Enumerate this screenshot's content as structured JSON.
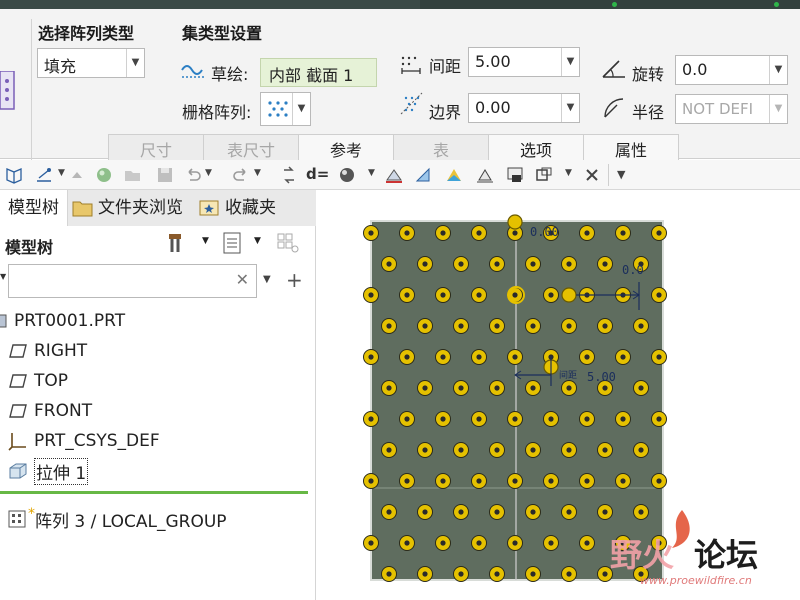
{
  "ribbon": {
    "pattern_type": {
      "title": "选择阵列类型",
      "value": "填充"
    },
    "set_type": {
      "title": "集类型设置",
      "sketch_label": "草绘:",
      "sketch_value": "内部 截面 1",
      "grid_label": "栅格阵列:"
    },
    "spacing": {
      "label": "间距",
      "value": "5.00"
    },
    "border": {
      "label": "边界",
      "value": "0.00"
    },
    "rotate": {
      "label": "旋转",
      "value": "0.0"
    },
    "radius": {
      "label": "半径",
      "value": "NOT DEFI"
    },
    "tabs": [
      {
        "label": "尺寸",
        "enabled": false
      },
      {
        "label": "表尺寸",
        "enabled": false
      },
      {
        "label": "参考",
        "enabled": true
      },
      {
        "label": "表",
        "enabled": false
      },
      {
        "label": "选项",
        "enabled": true
      },
      {
        "label": "属性",
        "enabled": true
      }
    ]
  },
  "toolbar": {
    "icons": [
      "orient-icon",
      "sketch-view-icon",
      "up-arrow-icon",
      "sphere-icon",
      "open-icon",
      "save-icon",
      "undo-icon",
      "redo-icon",
      "regenerate-icon",
      "dimension-icon",
      "appearance-icon",
      "datum-display-icon",
      "section-icon",
      "color-icon",
      "plane-display-icon",
      "screenshot-icon",
      "window-icon",
      "close-window-icon",
      "more-icon"
    ],
    "dimension_text": "d="
  },
  "left_panel": {
    "tabs": [
      "模型树",
      "文件夹浏览",
      "收藏夹"
    ],
    "tree_title": "模型树",
    "search": {
      "value": "",
      "placeholder": ""
    },
    "items": [
      {
        "label": "PRT0001.PRT",
        "icon": "part-icon"
      },
      {
        "label": "RIGHT",
        "icon": "datum-plane-icon"
      },
      {
        "label": "TOP",
        "icon": "datum-plane-icon"
      },
      {
        "label": "FRONT",
        "icon": "datum-plane-icon"
      },
      {
        "label": "PRT_CSYS_DEF",
        "icon": "csys-icon"
      },
      {
        "label": "拉伸 1",
        "icon": "extrude-icon"
      }
    ],
    "pattern_item": {
      "label": "阵列 3 / LOCAL_GROUP",
      "icon": "pattern-icon",
      "marker": "*"
    }
  },
  "canvas": {
    "dim_top": "0.00",
    "dim_right": "0.0",
    "spacing_tag": "间距",
    "spacing_value": "5.00",
    "colors": {
      "plate": "#5f6d5f",
      "hole": "#e5c100",
      "outline": "#d8dcd8",
      "dim": "#1b2e5c"
    }
  },
  "watermark": {
    "title": "野火论坛",
    "url": "www.proewildfire.cn"
  }
}
